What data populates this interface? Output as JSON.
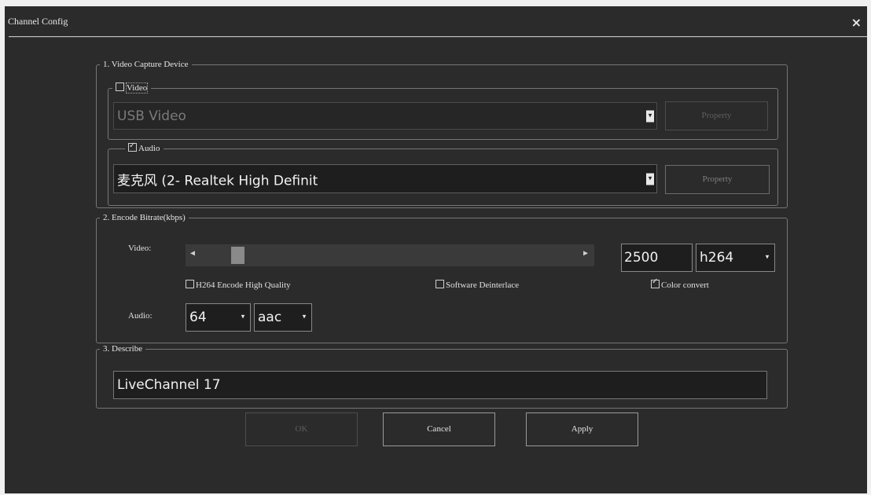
{
  "window": {
    "title": "Channel Config",
    "close_icon": "×"
  },
  "capture_group": {
    "label": "1. Video Capture Device",
    "video": {
      "checkbox_label": "Video",
      "checked": false,
      "device": "USB Video",
      "property_label": "Property"
    },
    "audio": {
      "checkbox_label": "Audio",
      "checked": true,
      "device": "麦克风 (2- Realtek High Definit",
      "property_label": "Property"
    }
  },
  "bitrate_group": {
    "label": "2. Encode Bitrate(kbps)",
    "video_label": "Video:",
    "video_bitrate": "2500",
    "video_codec": "h264",
    "options": {
      "h264_hq": {
        "label": "H264 Encode High Quality",
        "checked": false
      },
      "deinterlace": {
        "label": "Software Deinterlace",
        "checked": false
      },
      "color_convert": {
        "label": "Color convert",
        "checked": true
      }
    },
    "audio_label": "Audio:",
    "audio_bitrate": "64",
    "audio_codec": "aac"
  },
  "describe_group": {
    "label": "3. Describe",
    "value": "LiveChannel 17"
  },
  "buttons": {
    "ok": "OK",
    "cancel": "Cancel",
    "apply": "Apply"
  }
}
